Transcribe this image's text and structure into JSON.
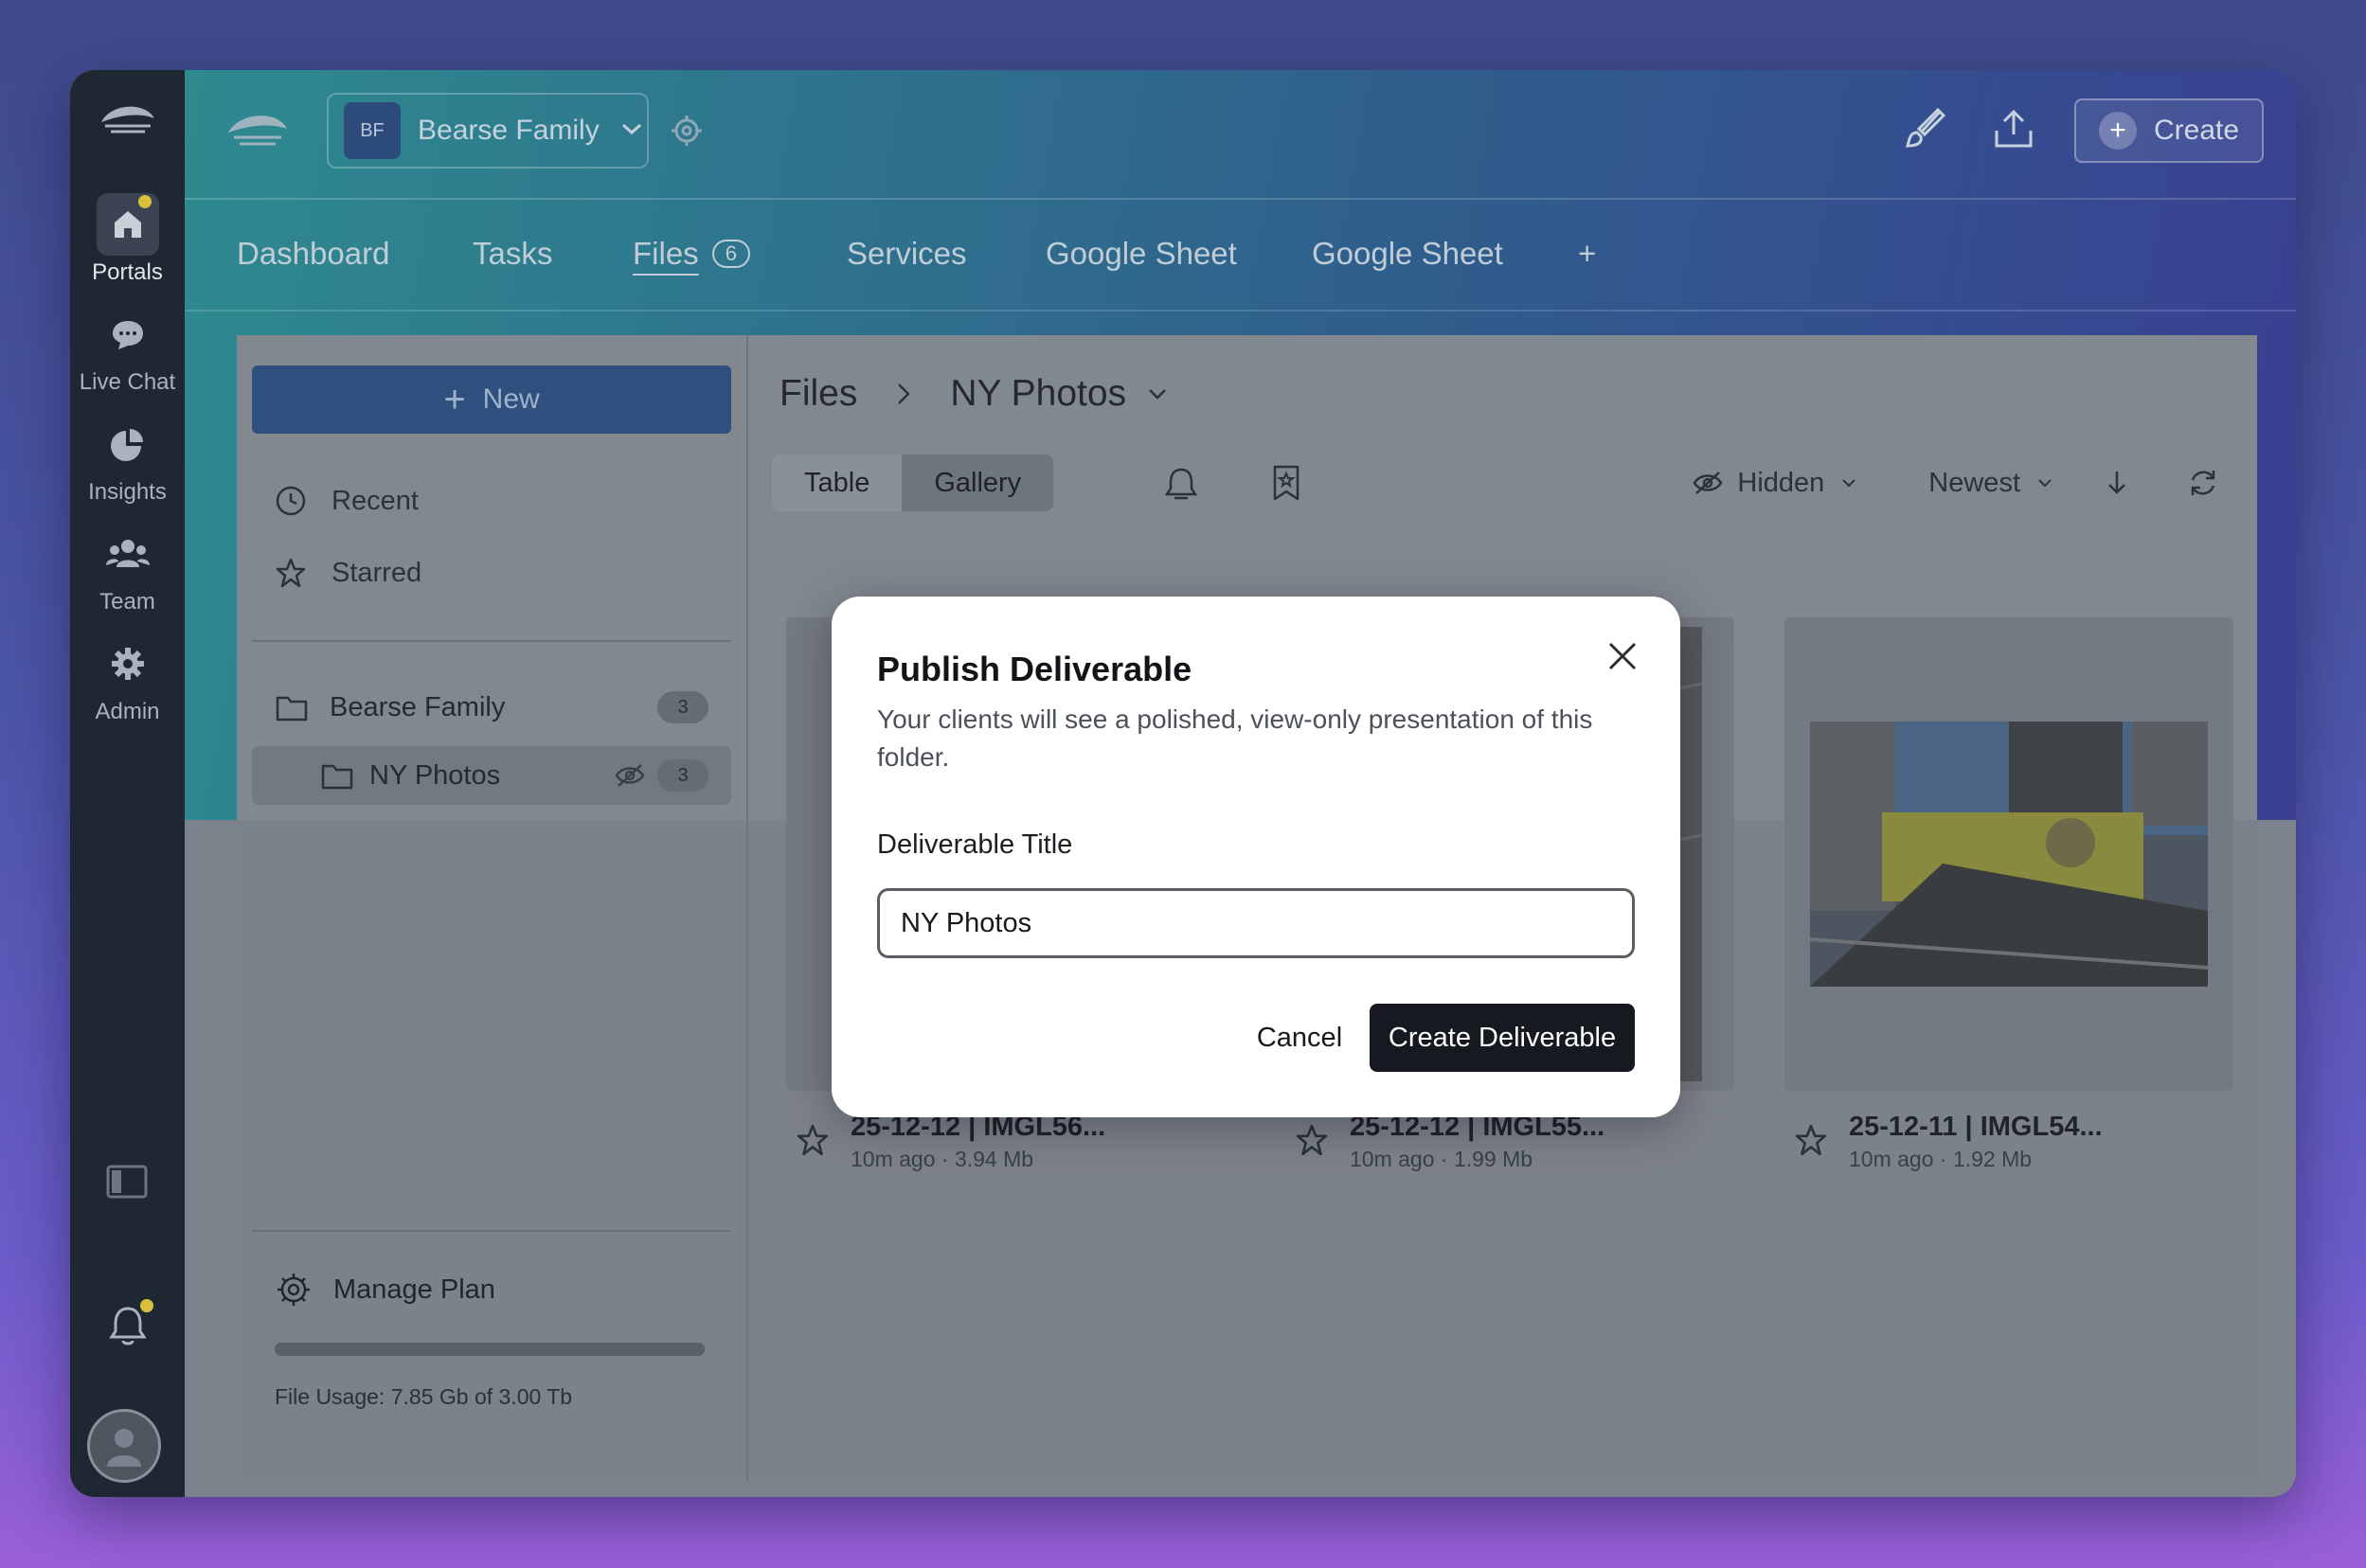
{
  "rail": {
    "items": [
      {
        "label": "Portals"
      },
      {
        "label": "Live Chat"
      },
      {
        "label": "Insights"
      },
      {
        "label": "Team"
      },
      {
        "label": "Admin"
      }
    ]
  },
  "header": {
    "workspace_initials": "BF",
    "workspace_name": "Bearse Family",
    "create_label": "Create"
  },
  "tabs": {
    "items": [
      {
        "label": "Dashboard"
      },
      {
        "label": "Tasks"
      },
      {
        "label": "Files",
        "badge": "6"
      },
      {
        "label": "Services"
      },
      {
        "label": "Google Sheet"
      },
      {
        "label": "Google Sheet"
      },
      {
        "label": "+"
      }
    ]
  },
  "sidebar": {
    "new_label": "New",
    "recent_label": "Recent",
    "starred_label": "Starred",
    "folders": [
      {
        "name": "Bearse Family",
        "count": "3"
      },
      {
        "name": "NY Photos",
        "count": "3"
      }
    ],
    "manage_plan_label": "Manage Plan",
    "usage_fraction": 1.0,
    "usage_text": "File Usage: 7.85 Gb of 3.00 Tb"
  },
  "files": {
    "breadcrumb_root": "Files",
    "breadcrumb_current": "NY Photos",
    "view_table": "Table",
    "view_gallery": "Gallery",
    "filter_hidden": "Hidden",
    "sort_label": "Newest",
    "tiles": [
      {
        "title": "25-12-12 | IMGL56...",
        "meta": "10m ago · 3.94 Mb"
      },
      {
        "title": "25-12-12 | IMGL55...",
        "meta": "10m ago · 1.99 Mb"
      },
      {
        "title": "25-12-11 | IMGL54...",
        "meta": "10m ago · 1.92 Mb"
      }
    ]
  },
  "modal": {
    "title": "Publish Deliverable",
    "description": "Your clients will see a polished, view-only presentation of this folder.",
    "field_label": "Deliverable Title",
    "field_value": "NY Photos",
    "cancel_label": "Cancel",
    "create_label": "Create Deliverable"
  }
}
